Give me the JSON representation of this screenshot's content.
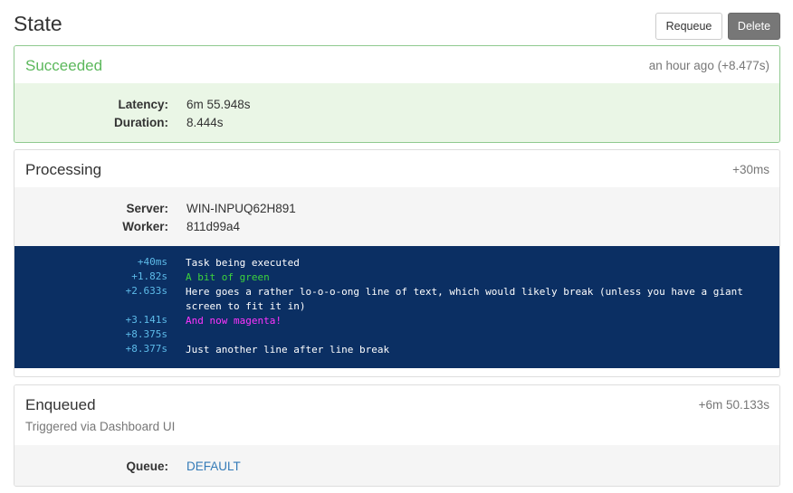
{
  "header": {
    "title": "State",
    "requeue_label": "Requeue",
    "delete_label": "Delete"
  },
  "succeeded": {
    "title": "Succeeded",
    "time": "an hour ago (+8.477s)",
    "props": [
      {
        "key": "Latency:",
        "value": "6m 55.948s"
      },
      {
        "key": "Duration:",
        "value": "8.444s"
      }
    ]
  },
  "processing": {
    "title": "Processing",
    "time": "+30ms",
    "props": [
      {
        "key": "Server:",
        "value": "WIN-INPUQ62H891"
      },
      {
        "key": "Worker:",
        "value": "811d99a4"
      }
    ],
    "console": [
      {
        "time": "+40ms",
        "text": "Task being executed",
        "color": "#ffffff"
      },
      {
        "time": "+1.82s",
        "text": "A bit of green",
        "color": "#3cd33c"
      },
      {
        "time": "+2.633s",
        "text": "Here goes a rather lo-o-o-ong line of text, which would likely break (unless you have a giant screen to fit it in)",
        "color": "#ffffff"
      },
      {
        "time": "+3.141s",
        "text": "And now magenta!",
        "color": "#ff33ff"
      },
      {
        "time": "+8.375s",
        "text": "",
        "color": "#ffffff"
      },
      {
        "time": "+8.377s",
        "text": "Just another line after line break",
        "color": "#ffffff"
      }
    ]
  },
  "enqueued": {
    "title": "Enqueued",
    "subtitle": "Triggered via Dashboard UI",
    "time": "+6m 50.133s",
    "props": [
      {
        "key": "Queue:",
        "value": "DEFAULT"
      }
    ]
  },
  "colors": {
    "success": "#5cb85c",
    "console_bg": "#0b2f63",
    "timestamp": "#5dbbe9",
    "link": "#337ab7"
  }
}
